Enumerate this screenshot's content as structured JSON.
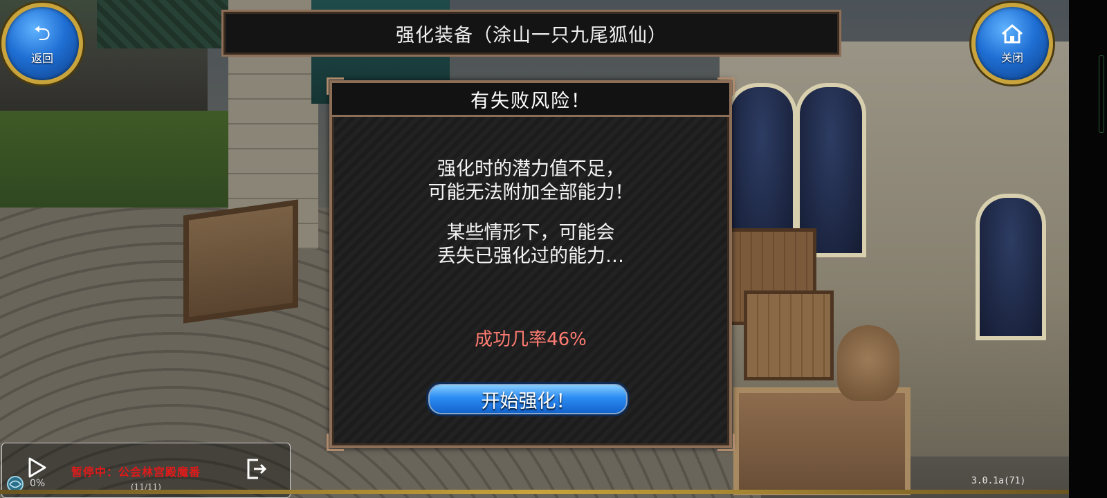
{
  "header": {
    "title": "强化装备（涂山一只九尾狐仙）",
    "back_label": "返回",
    "close_label": "关闭"
  },
  "dialog": {
    "title": "有失败风险！",
    "message_line1": "强化时的潜力值不足，",
    "message_line2": "可能无法附加全部能力！",
    "message_line3": "某些情形下，可能会",
    "message_line4": "丢失已强化过的能力…",
    "success_rate": "成功几率46%",
    "start_button": "开始强化！"
  },
  "recorder": {
    "status": "暂停中：公会林宫殿魔番",
    "count": "(11/11)",
    "progress": "0%"
  },
  "version": "3.0.1a(71)",
  "colors": {
    "accent_gold": "#c9a43c",
    "button_blue": "#2c8cf3",
    "success_text": "#ff7c72",
    "recorder_status": "#e21a1a"
  },
  "icons": {
    "back": "back-arrow-icon",
    "close": "home-icon",
    "play": "play-icon",
    "exit": "exit-icon",
    "network": "network-icon"
  }
}
